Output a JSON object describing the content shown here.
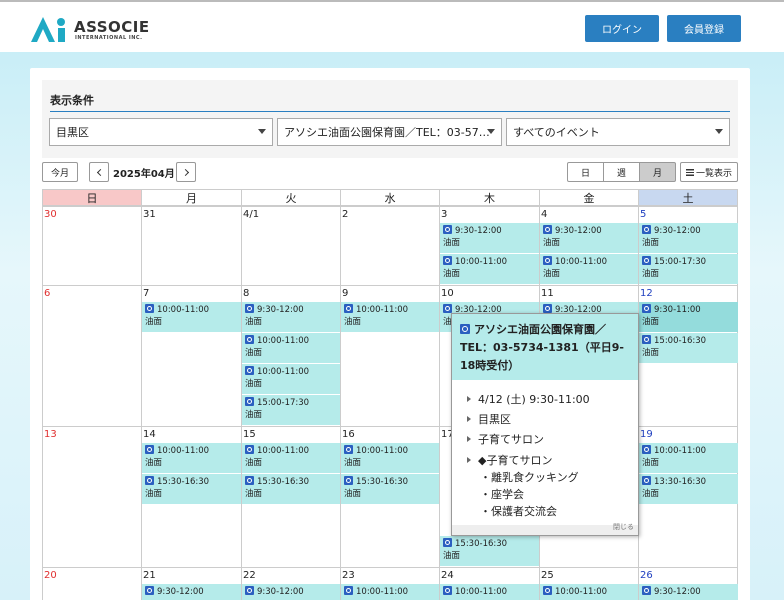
{
  "header": {
    "logo_name": "ASSOCIE",
    "logo_sub": "INTERNATIONAL INC.",
    "login_label": "ログイン",
    "register_label": "会員登録"
  },
  "filter": {
    "title": "表示条件",
    "area": "目黒区",
    "facility": "アソシエ油面公園保育園／TEL：03-57…",
    "event_type": "すべてのイベント"
  },
  "toolbar": {
    "today": "今月",
    "month_label": "2025年04月",
    "view_day": "日",
    "view_week": "週",
    "view_month": "月",
    "view_list": "一覧表示"
  },
  "weekdays": [
    "日",
    "月",
    "火",
    "水",
    "木",
    "金",
    "土"
  ],
  "weeks": [
    [
      "30",
      "31",
      "4/1",
      "2",
      "3",
      "4",
      "5"
    ],
    [
      "6",
      "7",
      "8",
      "9",
      "10",
      "11",
      "12"
    ],
    [
      "13",
      "14",
      "15",
      "16",
      "17",
      "18",
      "19"
    ],
    [
      "20",
      "21",
      "22",
      "23",
      "24",
      "25",
      "26"
    ]
  ],
  "events": [
    {
      "w": 0,
      "d": 4,
      "slot": 0,
      "time": "9:30-12:00",
      "place": "油面"
    },
    {
      "w": 0,
      "d": 4,
      "slot": 1,
      "time": "10:00-11:00",
      "place": "油面"
    },
    {
      "w": 0,
      "d": 5,
      "slot": 0,
      "time": "9:30-12:00",
      "place": "油面"
    },
    {
      "w": 0,
      "d": 5,
      "slot": 1,
      "time": "10:00-11:00",
      "place": "油面"
    },
    {
      "w": 0,
      "d": 6,
      "slot": 0,
      "time": "9:30-12:00",
      "place": "油面"
    },
    {
      "w": 0,
      "d": 6,
      "slot": 1,
      "time": "15:00-17:30",
      "place": "油面"
    },
    {
      "w": 1,
      "d": 1,
      "slot": 0,
      "time": "10:00-11:00",
      "place": "油面"
    },
    {
      "w": 1,
      "d": 2,
      "slot": 0,
      "time": "9:30-12:00",
      "place": "油面"
    },
    {
      "w": 1,
      "d": 2,
      "slot": 1,
      "time": "10:00-11:00",
      "place": "油面"
    },
    {
      "w": 1,
      "d": 2,
      "slot": 2,
      "time": "10:00-11:00",
      "place": "油面"
    },
    {
      "w": 1,
      "d": 2,
      "slot": 3,
      "time": "15:00-17:30",
      "place": "油面"
    },
    {
      "w": 1,
      "d": 3,
      "slot": 0,
      "time": "10:00-11:00",
      "place": "油面"
    },
    {
      "w": 1,
      "d": 4,
      "slot": 0,
      "time": "9:30-12:00",
      "place": "油面"
    },
    {
      "w": 1,
      "d": 5,
      "slot": 0,
      "time": "9:30-12:00",
      "place": "油面"
    },
    {
      "w": 1,
      "d": 6,
      "slot": 0,
      "time": "9:30-11:00",
      "place": "油面",
      "active": true
    },
    {
      "w": 1,
      "d": 6,
      "slot": 1,
      "time": "15:00-16:30",
      "place": "油面"
    },
    {
      "w": 2,
      "d": 1,
      "slot": 0,
      "time": "10:00-11:00",
      "place": "油面"
    },
    {
      "w": 2,
      "d": 1,
      "slot": 1,
      "time": "15:30-16:30",
      "place": "油面"
    },
    {
      "w": 2,
      "d": 2,
      "slot": 0,
      "time": "10:00-11:00",
      "place": "油面"
    },
    {
      "w": 2,
      "d": 2,
      "slot": 1,
      "time": "15:30-16:30",
      "place": "油面"
    },
    {
      "w": 2,
      "d": 3,
      "slot": 0,
      "time": "10:00-11:00",
      "place": "油面"
    },
    {
      "w": 2,
      "d": 3,
      "slot": 1,
      "time": "15:30-16:30",
      "place": "油面"
    },
    {
      "w": 2,
      "d": 4,
      "slot": 3,
      "time": "15:30-16:30",
      "place": "油面"
    },
    {
      "w": 2,
      "d": 6,
      "slot": 0,
      "time": "10:00-11:00",
      "place": "油面"
    },
    {
      "w": 2,
      "d": 6,
      "slot": 1,
      "time": "13:30-16:30",
      "place": "油面"
    },
    {
      "w": 3,
      "d": 1,
      "slot": 0,
      "time": "9:30-12:00",
      "place": ""
    },
    {
      "w": 3,
      "d": 2,
      "slot": 0,
      "time": "9:30-12:00",
      "place": ""
    },
    {
      "w": 3,
      "d": 3,
      "slot": 0,
      "time": "10:00-11:00",
      "place": ""
    },
    {
      "w": 3,
      "d": 4,
      "slot": 0,
      "time": "10:00-11:00",
      "place": ""
    },
    {
      "w": 3,
      "d": 5,
      "slot": 0,
      "time": "10:00-11:00",
      "place": ""
    },
    {
      "w": 3,
      "d": 6,
      "slot": 0,
      "time": "9:30-12:00",
      "place": ""
    }
  ],
  "popup": {
    "title": "アソシエ油面公園保育園／TEL：03-5734-1381（平日9-18時受付）",
    "date_time": "4/12 (土) 9:30-11:00",
    "area": "目黒区",
    "category": "子育てサロン",
    "detail_title": "◆子育てサロン",
    "detail_items": [
      "・離乳食クッキング",
      "・座学会",
      "・保護者交流会"
    ],
    "close_label": "閉じる"
  }
}
